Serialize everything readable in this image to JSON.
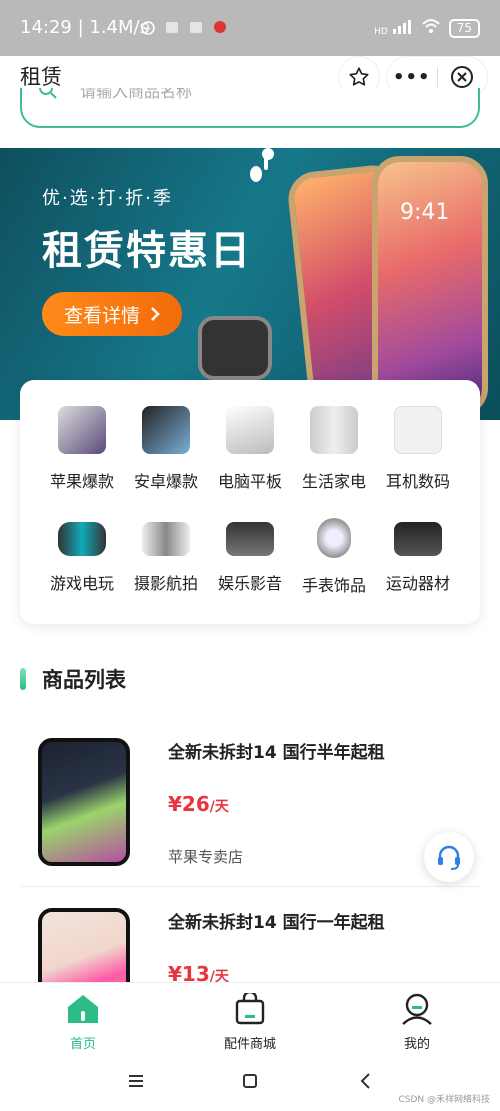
{
  "status_bar": {
    "time": "14:29 | 1.4M/s",
    "battery": "75",
    "network": "HD"
  },
  "header": {
    "title": "租赁",
    "favorite_icon": "star-icon",
    "more_icon": "more-dots-icon",
    "close_icon": "close-circle-icon"
  },
  "search": {
    "placeholder": "请输入商品名称"
  },
  "banner": {
    "subtitle": "优·选·打·折·季",
    "headline": "租赁特惠日",
    "cta_label": "查看详情",
    "phone_clock": "9:41"
  },
  "categories": [
    {
      "label": "苹果爆款",
      "icon": "iphone-icon"
    },
    {
      "label": "安卓爆款",
      "icon": "android-phone-icon"
    },
    {
      "label": "电脑平板",
      "icon": "laptop-icon"
    },
    {
      "label": "生活家电",
      "icon": "fridge-icon"
    },
    {
      "label": "耳机数码",
      "icon": "earbuds-icon"
    },
    {
      "label": "游戏电玩",
      "icon": "game-console-icon"
    },
    {
      "label": "摄影航拍",
      "icon": "drone-icon"
    },
    {
      "label": "娱乐影音",
      "icon": "projector-icon"
    },
    {
      "label": "手表饰品",
      "icon": "watch-icon"
    },
    {
      "label": "运动器材",
      "icon": "stepper-icon"
    }
  ],
  "product_section": {
    "title": "商品列表"
  },
  "products": [
    {
      "name": "全新未拆封14 国行半年起租",
      "price": "¥26",
      "unit": "/天",
      "shop": "苹果专卖店"
    },
    {
      "name": "全新未拆封14 国行一年起租",
      "price": "¥13",
      "unit": "/天",
      "shop": ""
    }
  ],
  "tab_bar": [
    {
      "label": "首页",
      "icon": "home-icon",
      "active": true
    },
    {
      "label": "配件商城",
      "icon": "shopping-bag-icon",
      "active": false
    },
    {
      "label": "我的",
      "icon": "user-icon",
      "active": false
    }
  ],
  "watermark": "CSDN @禾祥网络科技",
  "colors": {
    "accent": "#2bbd85",
    "price": "#e8353d",
    "cta": "#f26b0a",
    "banner_bg": "#16788a"
  }
}
